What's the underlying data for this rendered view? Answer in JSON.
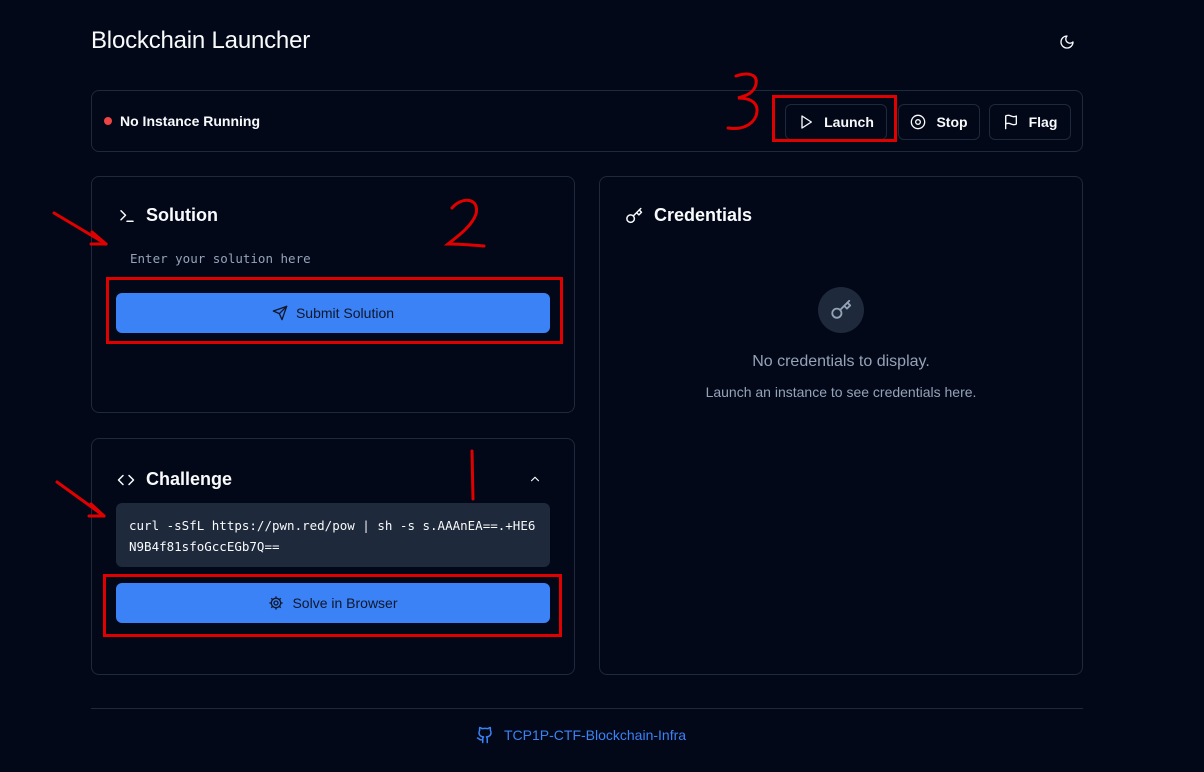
{
  "app": {
    "title": "Blockchain Launcher"
  },
  "status_bar": {
    "status_text": "No Instance Running",
    "buttons": {
      "launch": "Launch",
      "stop": "Stop",
      "flag": "Flag"
    }
  },
  "solution": {
    "title": "Solution",
    "input_placeholder": "Enter your solution here",
    "input_value": "",
    "submit_label": "Submit Solution"
  },
  "challenge": {
    "title": "Challenge",
    "command": "curl -sSfL https://pwn.red/pow | sh -s s.AAAnEA==.+HE6N9B4f81sfoGccEGb7Q==",
    "solve_label": "Solve in Browser"
  },
  "credentials": {
    "title": "Credentials",
    "empty_title": "No credentials to display.",
    "empty_subtitle": "Launch an instance to see credentials here."
  },
  "footer": {
    "link_text": "TCP1P-CTF-Blockchain-Infra"
  },
  "annotations": {
    "number_1": "1",
    "number_2": "2",
    "number_3": "3"
  },
  "colors": {
    "background": "#020817",
    "border": "#1e293b",
    "accent": "#3b82f6",
    "status_red": "#ef4444",
    "annotation_red": "#e00000"
  },
  "icons": {
    "theme": "moon-icon",
    "launch": "play-icon",
    "stop": "stop-circle-icon",
    "flag": "flag-icon",
    "solution": "terminal-icon",
    "submit": "send-icon",
    "challenge": "code-icon",
    "collapse": "chevron-up-icon",
    "solve": "gear-icon",
    "credentials": "key-icon",
    "footer": "github-icon"
  }
}
